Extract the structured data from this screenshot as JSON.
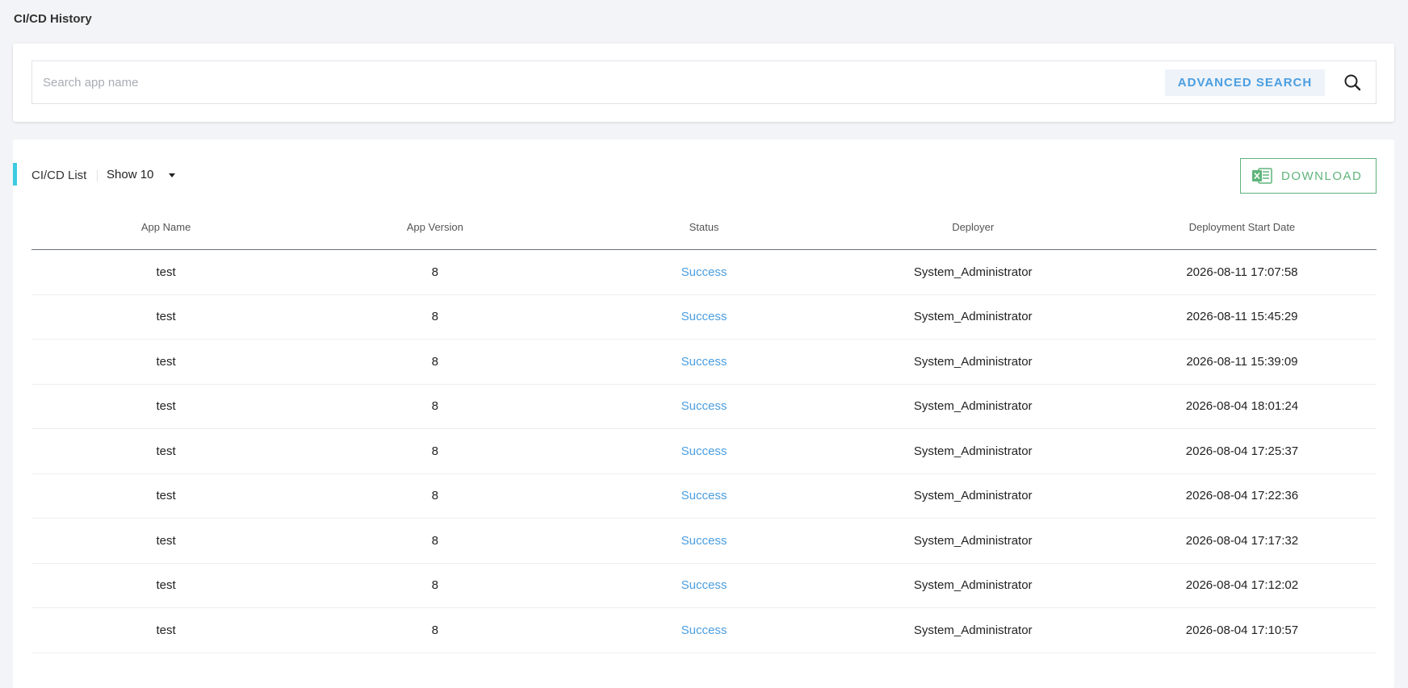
{
  "page": {
    "title": "CI/CD History"
  },
  "search": {
    "placeholder": "Search app name",
    "value": "",
    "advanced_label": "ADVANCED SEARCH",
    "icon": "search-icon"
  },
  "list": {
    "title": "CI/CD List",
    "show_label": "Show 10",
    "download_label": "DOWNLOAD",
    "download_icon": "excel-icon",
    "accent_color": "#3ccbe0",
    "columns": [
      "App Name",
      "App Version",
      "Status",
      "Deployer",
      "Deployment Start Date"
    ],
    "rows": [
      {
        "app_name": "test",
        "app_version": "8",
        "status": "Success",
        "deployer": "System_Administrator",
        "start_date": "2026-08-11 17:07:58"
      },
      {
        "app_name": "test",
        "app_version": "8",
        "status": "Success",
        "deployer": "System_Administrator",
        "start_date": "2026-08-11 15:45:29"
      },
      {
        "app_name": "test",
        "app_version": "8",
        "status": "Success",
        "deployer": "System_Administrator",
        "start_date": "2026-08-11 15:39:09"
      },
      {
        "app_name": "test",
        "app_version": "8",
        "status": "Success",
        "deployer": "System_Administrator",
        "start_date": "2026-08-04 18:01:24"
      },
      {
        "app_name": "test",
        "app_version": "8",
        "status": "Success",
        "deployer": "System_Administrator",
        "start_date": "2026-08-04 17:25:37"
      },
      {
        "app_name": "test",
        "app_version": "8",
        "status": "Success",
        "deployer": "System_Administrator",
        "start_date": "2026-08-04 17:22:36"
      },
      {
        "app_name": "test",
        "app_version": "8",
        "status": "Success",
        "deployer": "System_Administrator",
        "start_date": "2026-08-04 17:17:32"
      },
      {
        "app_name": "test",
        "app_version": "8",
        "status": "Success",
        "deployer": "System_Administrator",
        "start_date": "2026-08-04 17:12:02"
      },
      {
        "app_name": "test",
        "app_version": "8",
        "status": "Success",
        "deployer": "System_Administrator",
        "start_date": "2026-08-04 17:10:57"
      }
    ]
  },
  "colors": {
    "link": "#4a9ee0",
    "download_green": "#5fb47a",
    "background": "#f3f4f7"
  }
}
